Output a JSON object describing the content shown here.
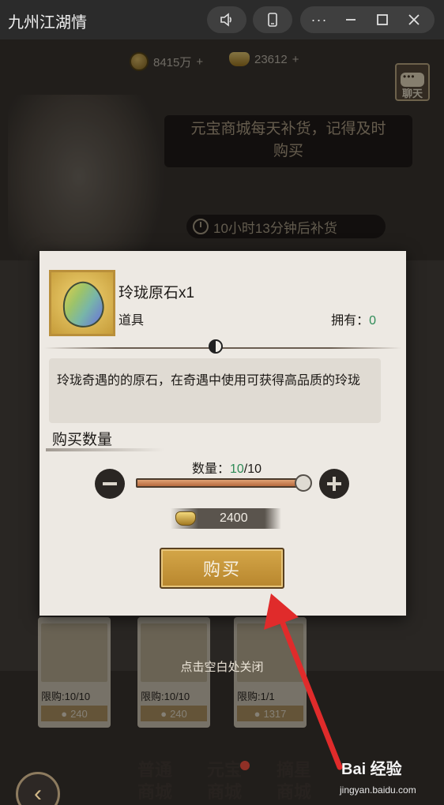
{
  "window": {
    "title": "九州江湖情",
    "buttons": [
      "volume-icon",
      "phone-icon",
      "more-icon",
      "minimize-icon",
      "maximize-icon",
      "close-icon"
    ]
  },
  "header": {
    "coins": "8415万",
    "ingots": "23612",
    "chat_label": "聊天"
  },
  "banner": {
    "notice_line1": "元宝商城每天补货，记得及时",
    "notice_line2": "购买",
    "restock": "10小时13分钟后补货"
  },
  "shop_cards": [
    {
      "limit": "限购:10/10",
      "price": "240"
    },
    {
      "limit": "限购:10/10",
      "price": "240"
    },
    {
      "limit": "限购:1/1",
      "price": "1317"
    }
  ],
  "close_hint": "点击空白处关闭",
  "nav_tabs": [
    {
      "line1": "普通",
      "line2": "商城"
    },
    {
      "line1": "元宝",
      "line2": "商城"
    },
    {
      "line1": "摘星",
      "line2": "商城"
    }
  ],
  "dialog": {
    "item_name": "玲珑原石x1",
    "item_type": "道具",
    "owned_label": "拥有：",
    "owned_count": "0",
    "description": "玲珑奇遇的的原石，在奇遇中使用可获得高品质的玲珑",
    "quantity_heading": "购买数量",
    "quantity_label": "数量：",
    "quantity_current": "10",
    "quantity_max": "/10",
    "slider_fraction": 1.0,
    "cost": "2400",
    "buy_label": "购买"
  },
  "watermark": {
    "brand": "Bai 经验",
    "url": "jingyan.baidu.com"
  },
  "colors": {
    "accent_green": "#2e8b57",
    "buy_gold": "#c9993b",
    "arrow_red": "#e02b2b"
  }
}
